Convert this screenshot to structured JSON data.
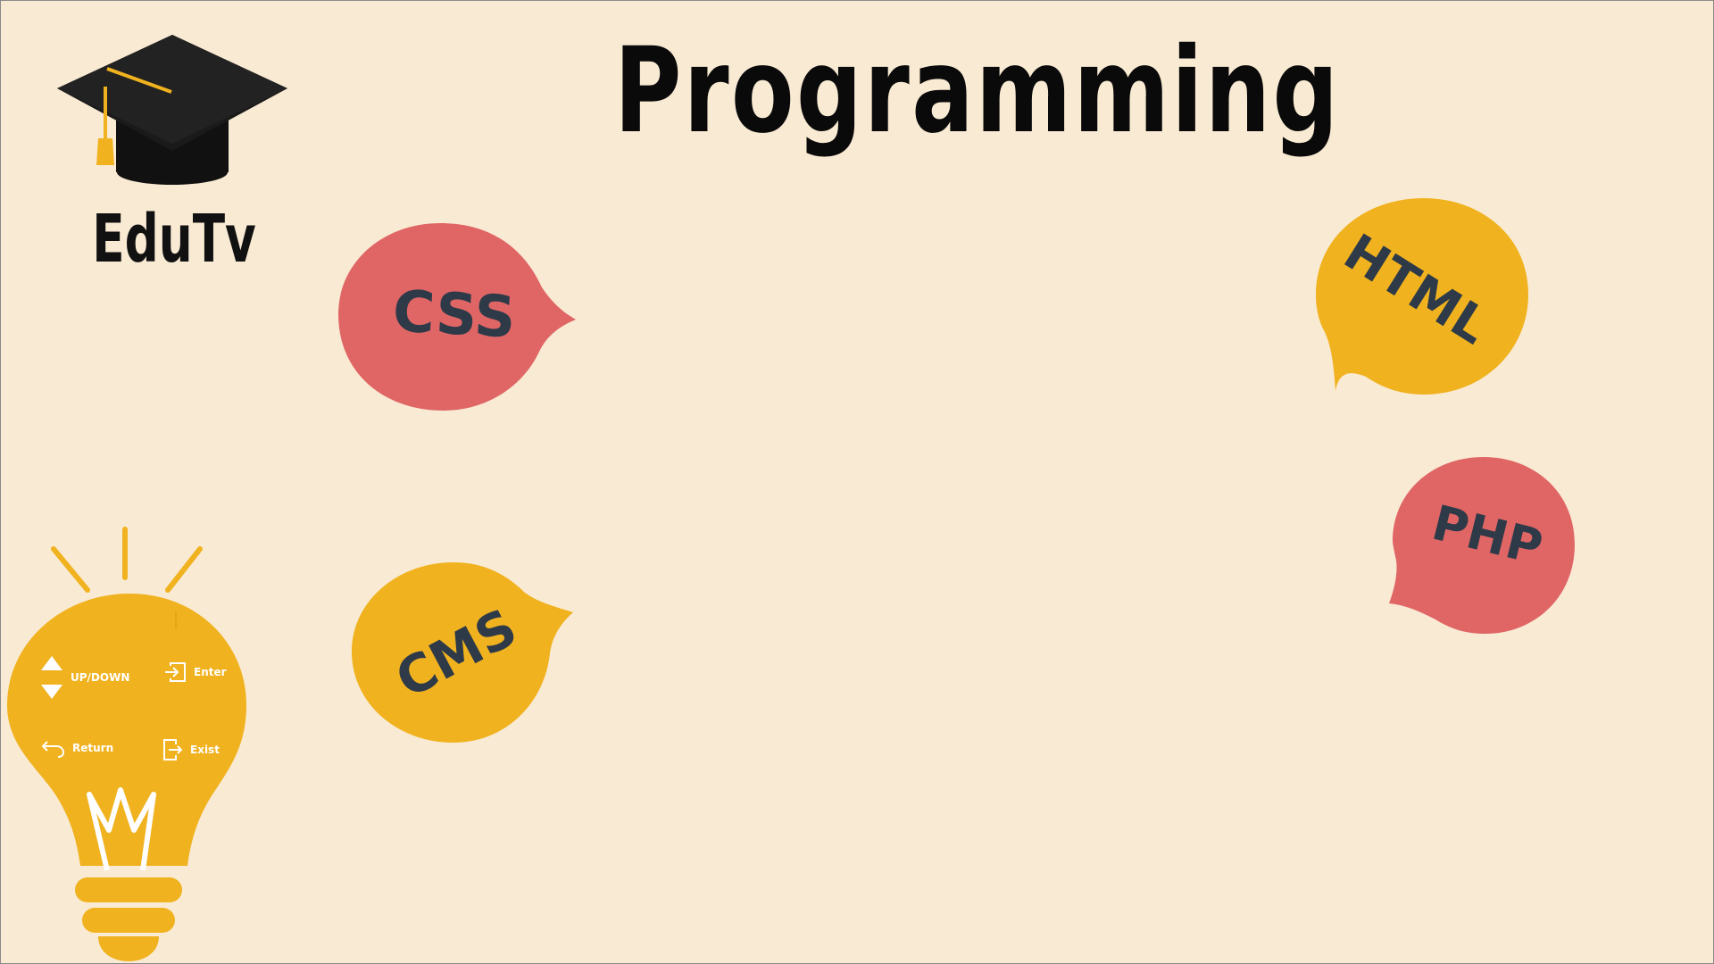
{
  "page": {
    "title": "Programming",
    "background": "#f9ead3"
  },
  "logo": {
    "text": "EduTv",
    "icon": "graduation-cap-icon"
  },
  "topics": [
    {
      "label": "CSS",
      "color": "#e06666",
      "icon": "speech-bubble"
    },
    {
      "label": "HTML",
      "color": "#f0b21f",
      "icon": "speech-bubble"
    },
    {
      "label": "PHP",
      "color": "#e06666",
      "icon": "speech-bubble"
    },
    {
      "label": "CMS",
      "color": "#f0b21f",
      "icon": "speech-bubble"
    }
  ],
  "controls": {
    "updown_label": "UP/DOWN",
    "enter_label": "Enter",
    "return_label": "Return",
    "exist_label": "Exist",
    "icons": [
      "up-down-arrows-icon",
      "enter-icon",
      "return-icon",
      "exit-icon"
    ]
  },
  "colors": {
    "accent_yellow": "#f0b21f",
    "accent_red": "#e06666",
    "label_dark": "#2e3a48"
  }
}
